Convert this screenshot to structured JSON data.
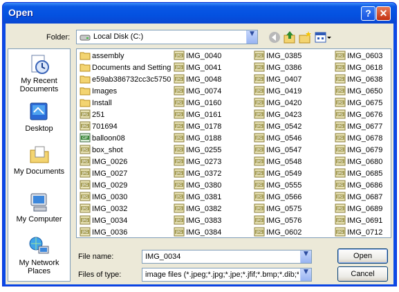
{
  "window": {
    "title": "Open",
    "help_label": "?",
    "close_label": "✕"
  },
  "folder_bar": {
    "label": "Folder:",
    "current": "Local Disk (C:)"
  },
  "places": [
    {
      "label": "My Recent Documents",
      "icon": "recent-documents-icon"
    },
    {
      "label": "Desktop",
      "icon": "desktop-icon"
    },
    {
      "label": "My Documents",
      "icon": "my-documents-icon"
    },
    {
      "label": "My Computer",
      "icon": "my-computer-icon"
    },
    {
      "label": "My Network Places",
      "icon": "network-places-icon"
    }
  ],
  "files": {
    "col1": [
      {
        "name": "assembly",
        "type": "folder"
      },
      {
        "name": "Documents and Setting",
        "type": "folder"
      },
      {
        "name": "e59ab386732cc3c5750",
        "type": "folder"
      },
      {
        "name": "Images",
        "type": "folder"
      },
      {
        "name": "Install",
        "type": "folder"
      },
      {
        "name": "251",
        "type": "jpg"
      },
      {
        "name": "701694",
        "type": "jpg"
      },
      {
        "name": "balloon08",
        "type": "gif"
      },
      {
        "name": "box_shot",
        "type": "jpg"
      },
      {
        "name": "IMG_0026",
        "type": "jpg"
      },
      {
        "name": "IMG_0027",
        "type": "jpg"
      },
      {
        "name": "IMG_0029",
        "type": "jpg"
      },
      {
        "name": "IMG_0030",
        "type": "jpg"
      },
      {
        "name": "IMG_0032",
        "type": "jpg"
      },
      {
        "name": "IMG_0034",
        "type": "jpg"
      },
      {
        "name": "IMG_0036",
        "type": "jpg"
      }
    ],
    "col2": [
      {
        "name": "IMG_0040",
        "type": "jpg"
      },
      {
        "name": "IMG_0041",
        "type": "jpg"
      },
      {
        "name": "IMG_0048",
        "type": "jpg"
      },
      {
        "name": "IMG_0074",
        "type": "jpg"
      },
      {
        "name": "IMG_0160",
        "type": "jpg"
      },
      {
        "name": "IMG_0161",
        "type": "jpg"
      },
      {
        "name": "IMG_0178",
        "type": "jpg"
      },
      {
        "name": "IMG_0188",
        "type": "jpg"
      },
      {
        "name": "IMG_0255",
        "type": "jpg"
      },
      {
        "name": "IMG_0273",
        "type": "jpg"
      },
      {
        "name": "IMG_0372",
        "type": "jpg"
      },
      {
        "name": "IMG_0380",
        "type": "jpg"
      },
      {
        "name": "IMG_0381",
        "type": "jpg"
      },
      {
        "name": "IMG_0382",
        "type": "jpg"
      },
      {
        "name": "IMG_0383",
        "type": "jpg"
      },
      {
        "name": "IMG_0384",
        "type": "jpg"
      }
    ],
    "col3": [
      {
        "name": "IMG_0385",
        "type": "jpg"
      },
      {
        "name": "IMG_0386",
        "type": "jpg"
      },
      {
        "name": "IMG_0407",
        "type": "jpg"
      },
      {
        "name": "IMG_0419",
        "type": "jpg"
      },
      {
        "name": "IMG_0420",
        "type": "jpg"
      },
      {
        "name": "IMG_0423",
        "type": "jpg"
      },
      {
        "name": "IMG_0542",
        "type": "jpg"
      },
      {
        "name": "IMG_0546",
        "type": "jpg"
      },
      {
        "name": "IMG_0547",
        "type": "jpg"
      },
      {
        "name": "IMG_0548",
        "type": "jpg"
      },
      {
        "name": "IMG_0549",
        "type": "jpg"
      },
      {
        "name": "IMG_0555",
        "type": "jpg"
      },
      {
        "name": "IMG_0566",
        "type": "jpg"
      },
      {
        "name": "IMG_0575",
        "type": "jpg"
      },
      {
        "name": "IMG_0576",
        "type": "jpg"
      },
      {
        "name": "IMG_0602",
        "type": "jpg"
      }
    ],
    "col4": [
      {
        "name": "IMG_0603",
        "type": "jpg"
      },
      {
        "name": "IMG_0618",
        "type": "jpg"
      },
      {
        "name": "IMG_0638",
        "type": "jpg"
      },
      {
        "name": "IMG_0650",
        "type": "jpg"
      },
      {
        "name": "IMG_0675",
        "type": "jpg"
      },
      {
        "name": "IMG_0676",
        "type": "jpg"
      },
      {
        "name": "IMG_0677",
        "type": "jpg"
      },
      {
        "name": "IMG_0678",
        "type": "jpg"
      },
      {
        "name": "IMG_0679",
        "type": "jpg"
      },
      {
        "name": "IMG_0680",
        "type": "jpg"
      },
      {
        "name": "IMG_0685",
        "type": "jpg"
      },
      {
        "name": "IMG_0686",
        "type": "jpg"
      },
      {
        "name": "IMG_0687",
        "type": "jpg"
      },
      {
        "name": "IMG_0689",
        "type": "jpg"
      },
      {
        "name": "IMG_0691",
        "type": "jpg"
      },
      {
        "name": "IMG_0712",
        "type": "jpg"
      }
    ]
  },
  "filename": {
    "label": "File name:",
    "value": "IMG_0034"
  },
  "filetype": {
    "label": "Files of type:",
    "value": "image files (*.jpeg;*.jpg;*.jpe;*.jfif;*.bmp;*.dib;*.g"
  },
  "buttons": {
    "open": "Open",
    "cancel": "Cancel"
  },
  "colors": {
    "title_bar": "#0451e0",
    "dialog_bg": "#ece9d8",
    "folder_yellow": "#f3d471",
    "jpg_icon": "#a8a05a",
    "gif_icon": "#3f8a3f"
  }
}
